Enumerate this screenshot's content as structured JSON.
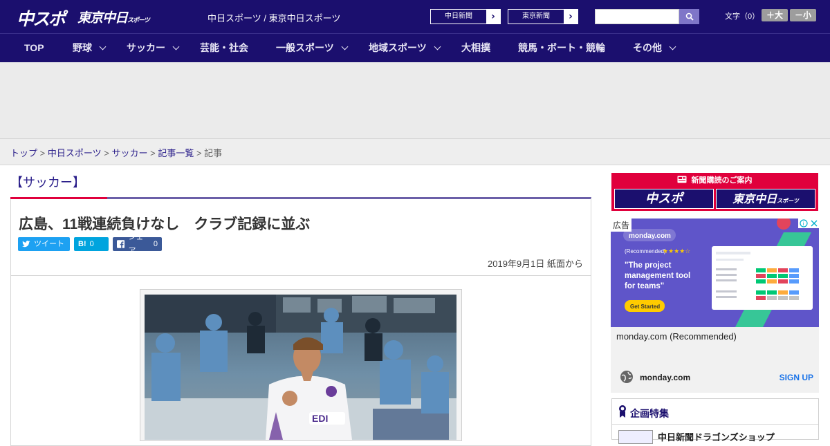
{
  "header": {
    "logo_main": "中スポ",
    "logo_tokyo": "東京中日",
    "logo_tokyo_small": "スポーツ",
    "site_names": "中日スポーツ / 東京中日スポーツ",
    "paper_buttons": [
      {
        "label": "中日新聞",
        "arrow": "›"
      },
      {
        "label": "東京新聞",
        "arrow": "›"
      }
    ],
    "search": {
      "value": "",
      "placeholder": ""
    },
    "font_size_label": "文字（0）",
    "font_larger": "＋大",
    "font_smaller": "－小"
  },
  "nav": {
    "items": [
      {
        "label": "TOP",
        "has_dropdown": false
      },
      {
        "label": "野球",
        "has_dropdown": true
      },
      {
        "label": "サッカー",
        "has_dropdown": true
      },
      {
        "label": "芸能・社会",
        "has_dropdown": false
      },
      {
        "label": "一般スポーツ",
        "has_dropdown": true
      },
      {
        "label": "地域スポーツ",
        "has_dropdown": true
      },
      {
        "label": "大相撲",
        "has_dropdown": false
      },
      {
        "label": "競馬・ボート・競輪",
        "has_dropdown": false
      },
      {
        "label": "その他",
        "has_dropdown": true
      }
    ]
  },
  "breadcrumb": {
    "items": [
      "トップ",
      "中日スポーツ",
      "サッカー",
      "記事一覧"
    ],
    "separator": ">",
    "current": "記事"
  },
  "article": {
    "category": "【サッカー】",
    "title": "広島、11戦連続負けなし　クラブ記録に並ぶ",
    "share": {
      "tweet_label": "ツイート",
      "hatena_label": "B!",
      "hatena_count": "0",
      "facebook_label": "シェア",
      "facebook_count": "0"
    },
    "date": "2019年9月1日 紙面から"
  },
  "sidebar": {
    "subscription_banner": {
      "title": "新聞購読のご案内",
      "logos": [
        "中スポ",
        "東京中日"
      ],
      "logo_small": "スポーツ"
    },
    "sponsor": {
      "ad_tag": "広告",
      "headline": "\"The project management tool for teams\"",
      "recommended": "(Recommended)",
      "cta_button": "Get Started",
      "brand": "monday.com",
      "name": "monday.com (Recommended)",
      "domain": "monday.com",
      "cta": "SIGN UP"
    },
    "feature": {
      "title": "企画特集",
      "first_item": "中日新聞ドラゴンズショップ"
    }
  },
  "colors": {
    "header_bg": "#1b0f6e",
    "accent_red": "#e0003c",
    "link": "#2a1e8a",
    "twitter": "#1da1f2",
    "hatena": "#00a4de",
    "facebook": "#3b5998",
    "sponsor_bg": "#5f55c9"
  }
}
